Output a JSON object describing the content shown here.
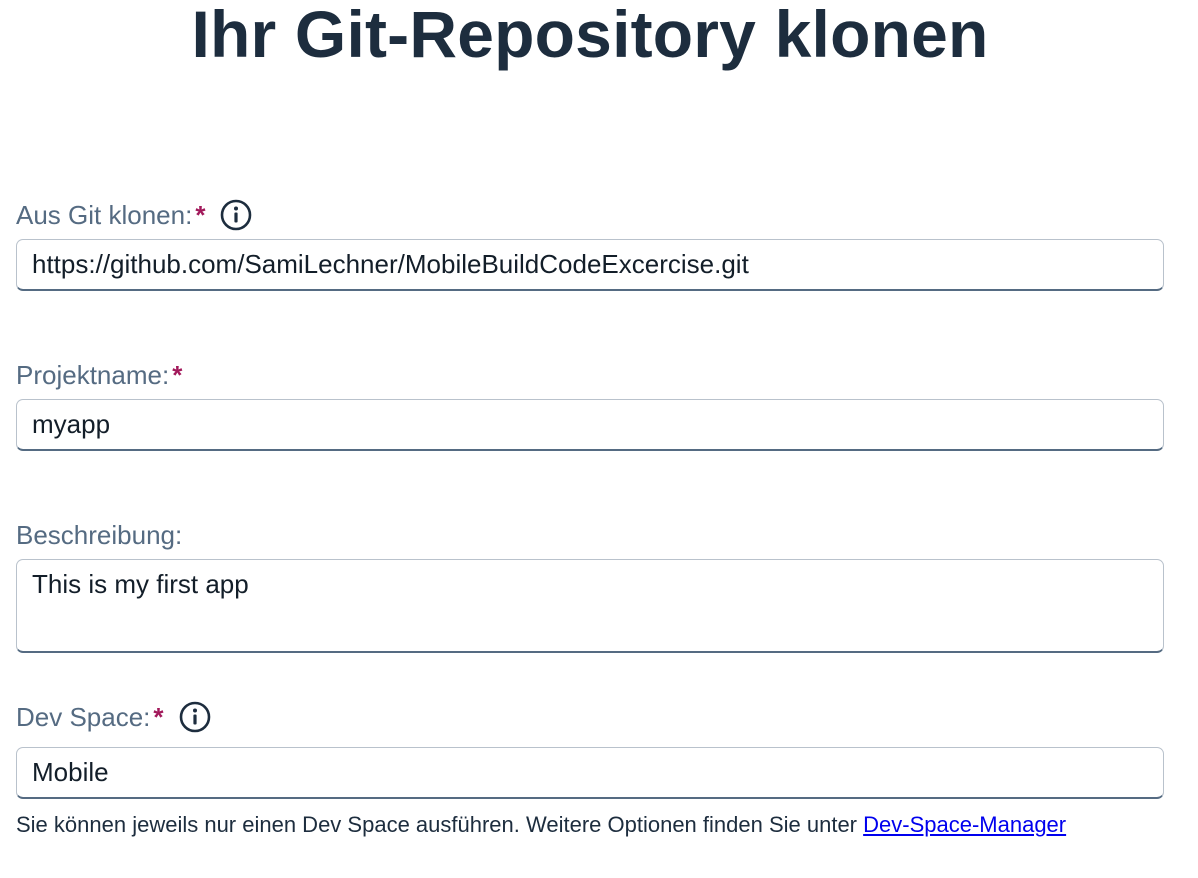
{
  "page": {
    "title": "Ihr Git-Repository klonen"
  },
  "form": {
    "git_clone": {
      "label": "Aus Git klonen:",
      "required_mark": "*",
      "info_icon": "info-circle-icon",
      "value": "https://github.com/SamiLechner/MobileBuildCodeExcercise.git"
    },
    "project_name": {
      "label": "Projektname:",
      "required_mark": "*",
      "value": "myapp"
    },
    "description": {
      "label": "Beschreibung:",
      "value": "This is my first app"
    },
    "dev_space": {
      "label": "Dev Space:",
      "required_mark": "*",
      "info_icon": "info-circle-icon",
      "value": "Mobile"
    },
    "hint": {
      "text": "Sie können jeweils nur einen Dev Space ausführen. Weitere Optionen finden Sie unter ",
      "link_label": "Dev-Space-Manager"
    }
  },
  "colors": {
    "title": "#1d2d3e",
    "label": "#556b82",
    "required": "#a2195b",
    "link": "#0000ee"
  }
}
